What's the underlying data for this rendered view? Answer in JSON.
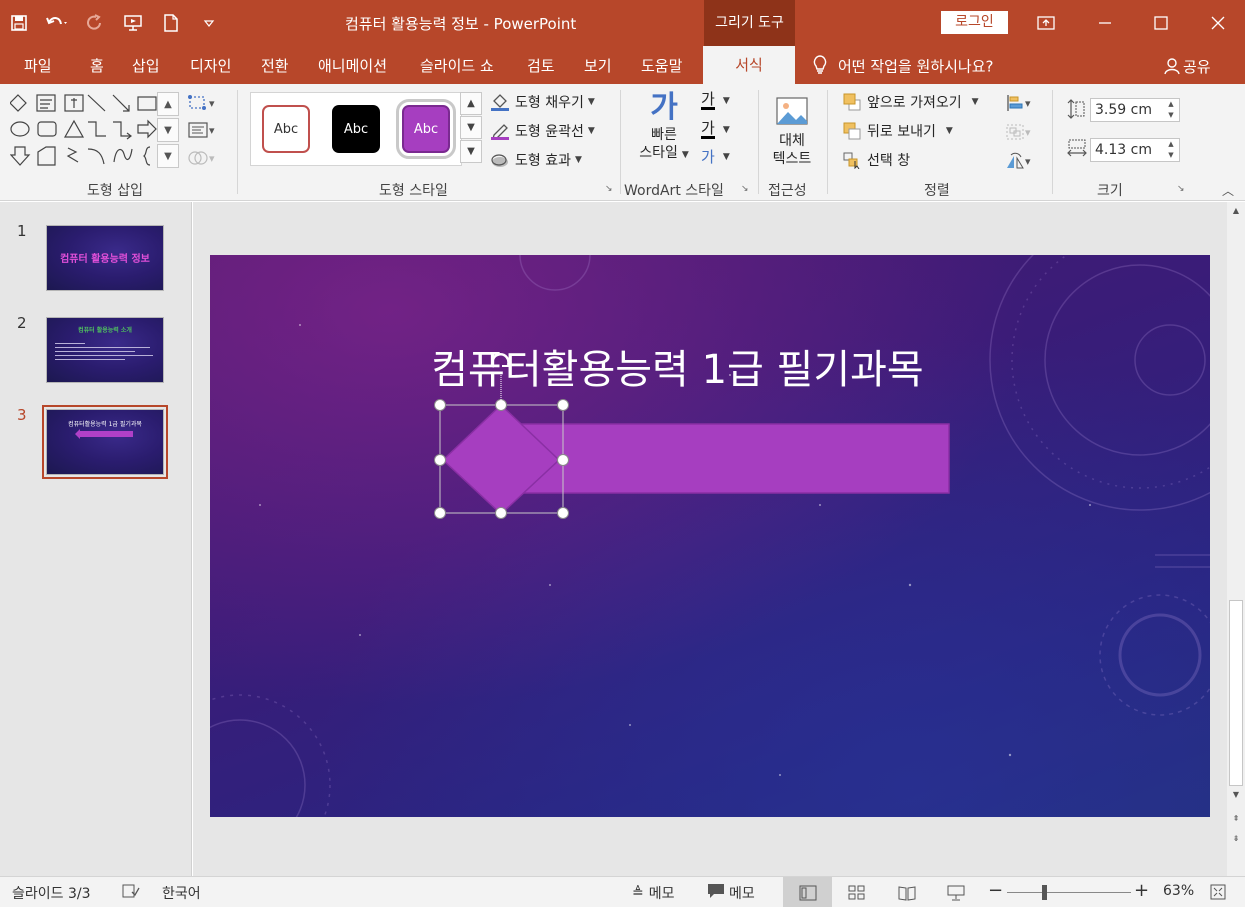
{
  "window": {
    "title": "컴퓨터 활용능력 정보  -  PowerPoint",
    "context_tab": "그리기 도구",
    "login": "로그인"
  },
  "tabs": [
    "파일",
    "홈",
    "삽입",
    "디자인",
    "전환",
    "애니메이션",
    "슬라이드 쇼",
    "검토",
    "보기",
    "도움말"
  ],
  "active_tab": "서식",
  "tell_me": "어떤 작업을 원하시나요?",
  "share": "공유",
  "ribbon": {
    "insert_shapes_label": "도형 삽입",
    "shape_styles_label": "도형 스타일",
    "style_swatches": [
      "Abc",
      "Abc",
      "Abc"
    ],
    "shape_fill": "도형 채우기",
    "shape_outline": "도형 윤곽선",
    "shape_effects": "도형 효과",
    "quick_styles_1": "빠른",
    "quick_styles_2": "스타일",
    "wordart_glyph": "가",
    "wordart_label": "WordArt 스타일",
    "alt_text_1": "대체",
    "alt_text_2": "텍스트",
    "accessibility_label": "접근성",
    "bring_forward": "앞으로 가져오기",
    "send_backward": "뒤로 보내기",
    "selection_pane": "선택 창",
    "arrange_label": "정렬",
    "height": "3.59 cm",
    "width": "4.13 cm",
    "size_label": "크기"
  },
  "slides": [
    {
      "num": "1",
      "title": "컴퓨터 활용능력 정보"
    },
    {
      "num": "2",
      "title": "컴퓨터 활용능력 소개"
    },
    {
      "num": "3",
      "title": "컴퓨터활용능력 1급 필기과목"
    }
  ],
  "current_slide_title": "컴퓨터활용능력 1급 필기과목",
  "status": {
    "slide_indicator": "슬라이드 3/3",
    "language": "한국어",
    "notes": "메모",
    "comments": "메모",
    "zoom": "63%"
  },
  "colors": {
    "accent": "#b7472a",
    "shape_fill": "#a63ec0"
  }
}
